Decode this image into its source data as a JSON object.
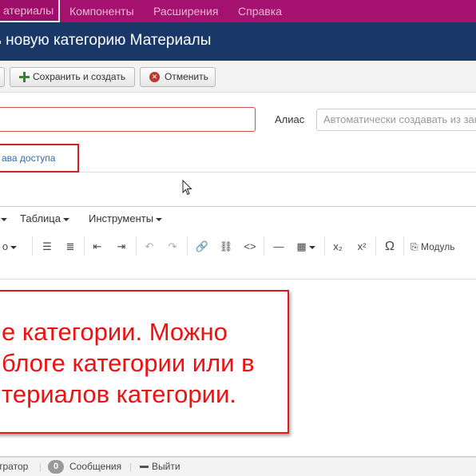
{
  "menubar": {
    "items": [
      {
        "label": "атериалы",
        "active": true
      },
      {
        "label": "Компоненты"
      },
      {
        "label": "Расширения"
      },
      {
        "label": "Справка"
      }
    ]
  },
  "header": {
    "title": "ь новую категорию Материалы"
  },
  "toolbar": {
    "save_new_label": "Сохранить и создать",
    "cancel_label": "Отменить"
  },
  "form": {
    "alias_label": "Алиас",
    "alias_placeholder": "Автоматически создавать из заг",
    "permissions_tab": "ава доступа"
  },
  "editor": {
    "menus": [
      {
        "label": "Таблица"
      },
      {
        "label": "Инструменты"
      }
    ],
    "module_button_label": "Модуль"
  },
  "callout": {
    "lines": [
      "е категории. Можно",
      "блоге категории или в",
      "териалов категории."
    ]
  },
  "status": {
    "admin_label": "тратор",
    "messages_count": "0",
    "messages_label": "Сообщения",
    "logout_label": "Выйти"
  },
  "colors": {
    "menubar": "#a5116e",
    "titlebar": "#1a3867",
    "annotation": "#ee1111"
  }
}
